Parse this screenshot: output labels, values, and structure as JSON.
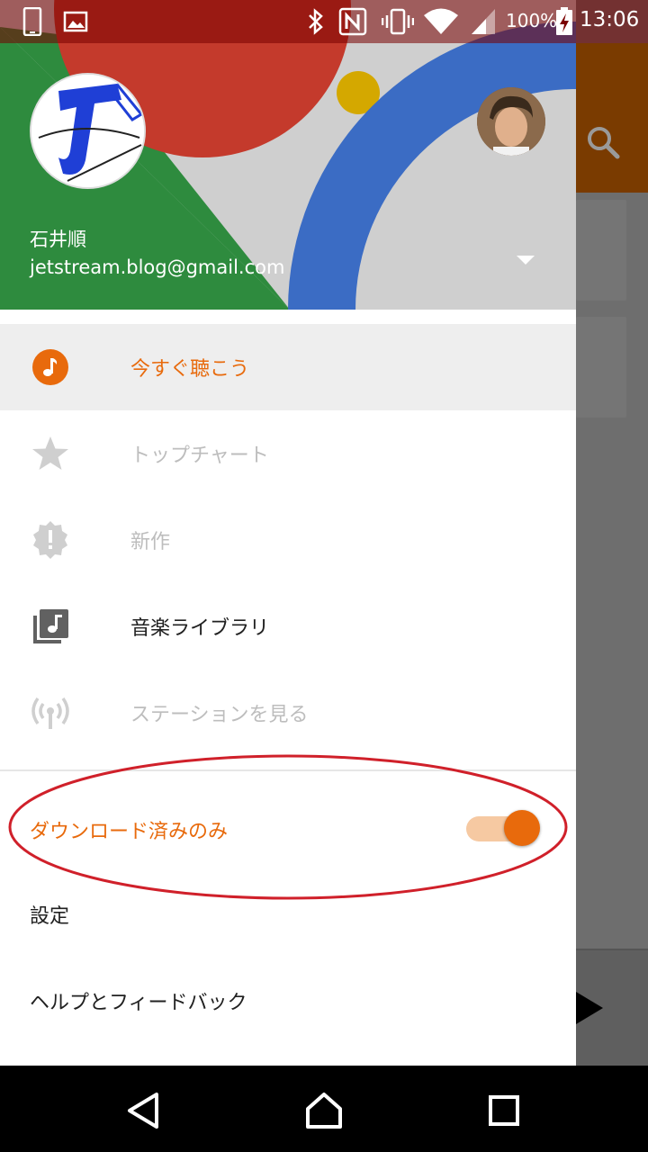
{
  "status_bar": {
    "battery_percent": "100%",
    "time": "13:06",
    "icons": [
      "phone-icon",
      "image-icon",
      "bluetooth-icon",
      "nfc-icon",
      "vibrate-icon",
      "wifi-icon",
      "signal-icon",
      "battery-charging-icon"
    ]
  },
  "drawer": {
    "account": {
      "name": "石井順",
      "email": "jetstream.blog@gmail.com"
    },
    "menu": [
      {
        "label": "今すぐ聴こう",
        "icon": "music-note-icon",
        "state": "active"
      },
      {
        "label": "トップチャート",
        "icon": "star-icon",
        "state": "disabled"
      },
      {
        "label": "新作",
        "icon": "alert-badge-icon",
        "state": "disabled"
      },
      {
        "label": "音楽ライブラリ",
        "icon": "library-music-icon",
        "state": "normal"
      },
      {
        "label": "ステーションを見る",
        "icon": "radio-station-icon",
        "state": "disabled"
      }
    ],
    "downloaded_only": {
      "label": "ダウンロード済みのみ",
      "enabled": true
    },
    "settings_label": "設定",
    "help_label": "ヘルプとフィードバック"
  },
  "colors": {
    "accent": "#e86a0c",
    "accent_light": "#f6c9a2",
    "annotation": "#d0202a"
  }
}
